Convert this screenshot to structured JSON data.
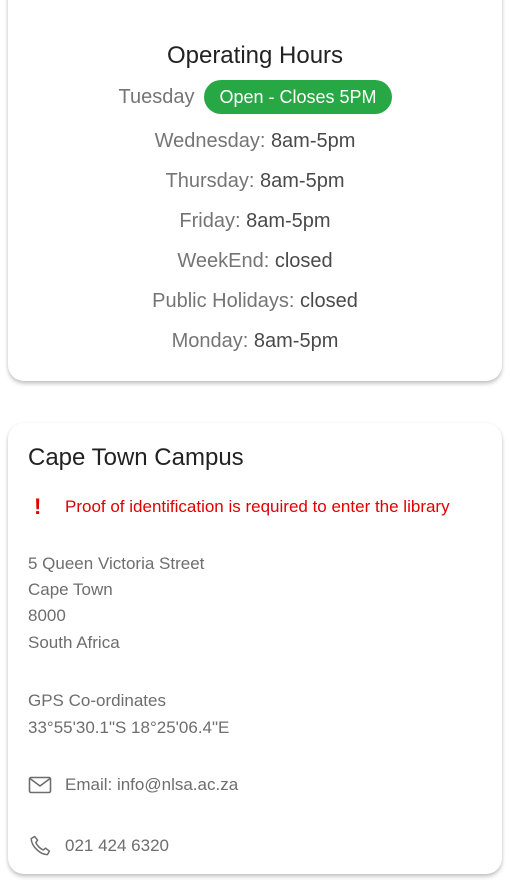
{
  "hours": {
    "title": "Operating Hours",
    "today": {
      "day": "Tuesday",
      "status": "Open - Closes 5PM",
      "status_color": "#28a745"
    },
    "rows": [
      {
        "day": "Wednesday:",
        "time": "8am-5pm"
      },
      {
        "day": "Thursday:",
        "time": "8am-5pm"
      },
      {
        "day": "Friday:",
        "time": "8am-5pm"
      },
      {
        "day": "WeekEnd:",
        "time": "closed"
      },
      {
        "day": "Public Holidays:",
        "time": "closed"
      },
      {
        "day": "Monday:",
        "time": "8am-5pm"
      }
    ]
  },
  "campus": {
    "title": "Cape Town Campus",
    "notice": {
      "icon": "exclamation-icon",
      "text": "Proof of identification is required to enter the library",
      "color": "#e00000"
    },
    "address": [
      "5 Queen Victoria Street",
      "Cape Town",
      "8000",
      "South Africa"
    ],
    "gps": {
      "label": "GPS Co-ordinates",
      "value": "33°55'30.1\"S 18°25'06.4\"E"
    },
    "email": {
      "icon": "envelope-icon",
      "text": "Email: info@nlsa.ac.za"
    },
    "phone": {
      "icon": "phone-icon",
      "text": "021 424 6320"
    }
  }
}
